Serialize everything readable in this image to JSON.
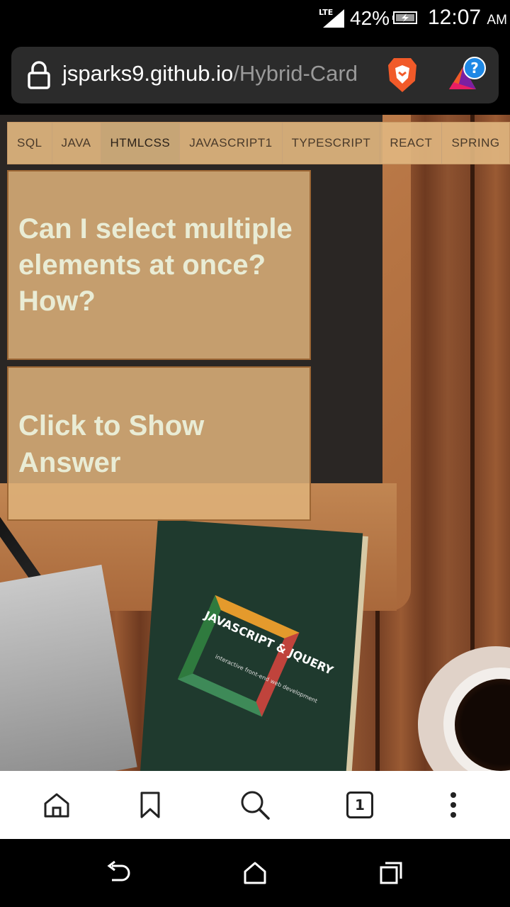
{
  "status": {
    "network": "LTE",
    "battery_percent": "42%",
    "time": "12:07",
    "ampm": "AM"
  },
  "browser": {
    "url_domain": "jsparks9.github.io",
    "url_path": "/Hybrid-Card"
  },
  "tabs": [
    {
      "label": "SQL",
      "active": false
    },
    {
      "label": "JAVA",
      "active": false
    },
    {
      "label": "HTMLCSS",
      "active": true
    },
    {
      "label": "JAVASCRIPT1",
      "active": false
    },
    {
      "label": "TYPESCRIPT",
      "active": false
    },
    {
      "label": "REACT",
      "active": false
    },
    {
      "label": "SPRING",
      "active": false
    }
  ],
  "cards": {
    "question": "Can I select multiple elements at once? How?",
    "answer_prompt": "Click to Show Answer"
  },
  "background_book": {
    "title": "JAVASCRIPT & JQUERY",
    "subtitle": "interactive front-end web development"
  },
  "toolbar": {
    "tab_count": "1",
    "icons": [
      "home-icon",
      "bookmark-icon",
      "search-icon",
      "tabs-icon",
      "more-icon"
    ]
  },
  "colors": {
    "tab_bar": "#e0b57f",
    "card_bg": "#deb27a",
    "card_text": "#e9ecd5",
    "brave_orange": "#f15a29"
  }
}
